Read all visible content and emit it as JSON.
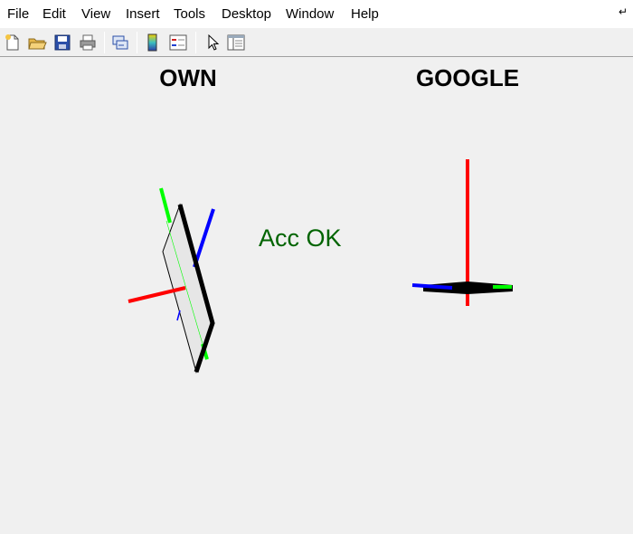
{
  "menu": [
    "File",
    "Edit",
    "View",
    "Insert",
    "Tools",
    "Desktop",
    "Window",
    "Help"
  ],
  "toolbar": [
    "new-figure-icon",
    "open-file-icon",
    "save-icon",
    "print-icon",
    "link-plot-icon",
    "colorbar-icon",
    "legend-icon",
    "edit-plot-pointer-icon",
    "property-inspector-icon"
  ],
  "panels": {
    "own_title": "OWN",
    "google_title": "GOOGLE"
  },
  "status": {
    "text": "Acc OK",
    "color": "#006400"
  },
  "axis_colors": {
    "x": "#ff0000",
    "y": "#00ff00",
    "z": "#0000ff"
  }
}
